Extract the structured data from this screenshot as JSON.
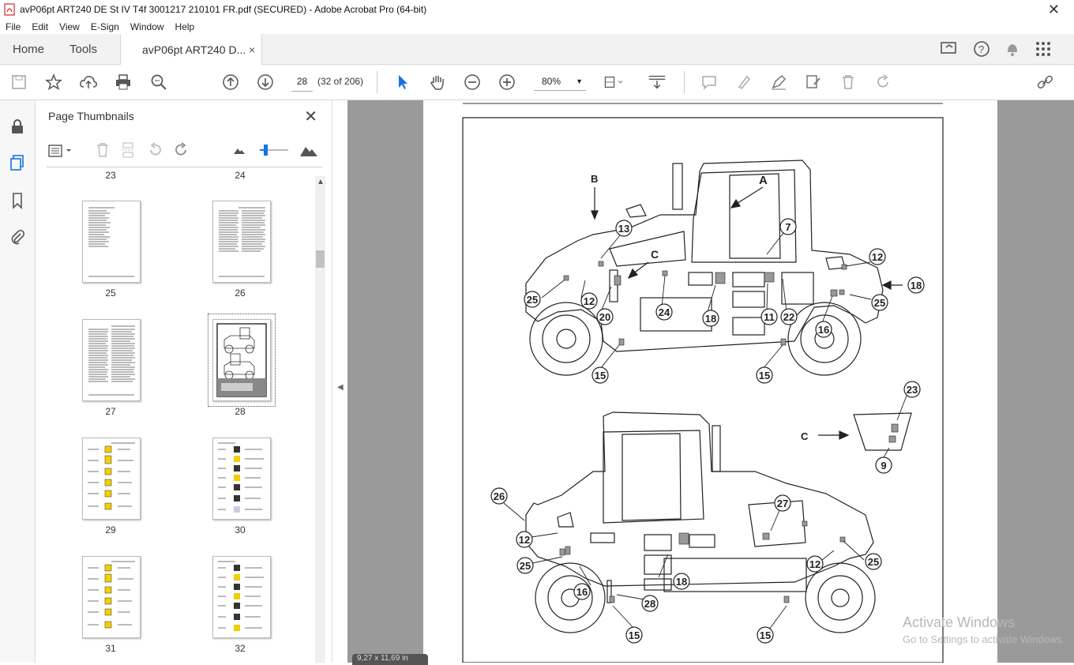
{
  "window": {
    "title": "avP06pt ART240 DE St IV T4f 3001217 210101 FR.pdf (SECURED) - Adobe Acrobat Pro (64-bit)",
    "close": "✕"
  },
  "menu": [
    "File",
    "Edit",
    "View",
    "E-Sign",
    "Window",
    "Help"
  ],
  "tabs": {
    "home": "Home",
    "tools": "Tools",
    "document": "avP06pt ART240 D...",
    "close": "×"
  },
  "toolbar": {
    "page_current": "28",
    "page_count": "(32 of 206)",
    "zoom": "80%"
  },
  "panel": {
    "title": "Page Thumbnails",
    "top_labels": [
      "23",
      "24"
    ],
    "thumbnails": [
      {
        "label": "25",
        "kind": "text"
      },
      {
        "label": "26",
        "kind": "text2"
      },
      {
        "label": "27",
        "kind": "text"
      },
      {
        "label": "28",
        "kind": "figure",
        "selected": true
      },
      {
        "label": "29",
        "kind": "symbols"
      },
      {
        "label": "30",
        "kind": "symbols2"
      },
      {
        "label": "31",
        "kind": "symbols"
      },
      {
        "label": "32",
        "kind": "symbols2"
      }
    ]
  },
  "figure": {
    "view_labels": [
      "A",
      "B",
      "C",
      "C"
    ],
    "callouts_top": [
      "13",
      "7",
      "12",
      "18",
      "25",
      "12",
      "20",
      "24",
      "18",
      "11",
      "22",
      "25",
      "16",
      "15",
      "15"
    ],
    "callouts_detail": [
      "23",
      "9"
    ],
    "callouts_bottom": [
      "26",
      "27",
      "12",
      "25",
      "16",
      "18",
      "28",
      "12",
      "25",
      "15",
      "15"
    ]
  },
  "status": {
    "page_size": "9,27 x 11,69 in"
  },
  "watermark": {
    "line1": "Activate Windows",
    "line2": "Go to Settings to activate Windows."
  }
}
